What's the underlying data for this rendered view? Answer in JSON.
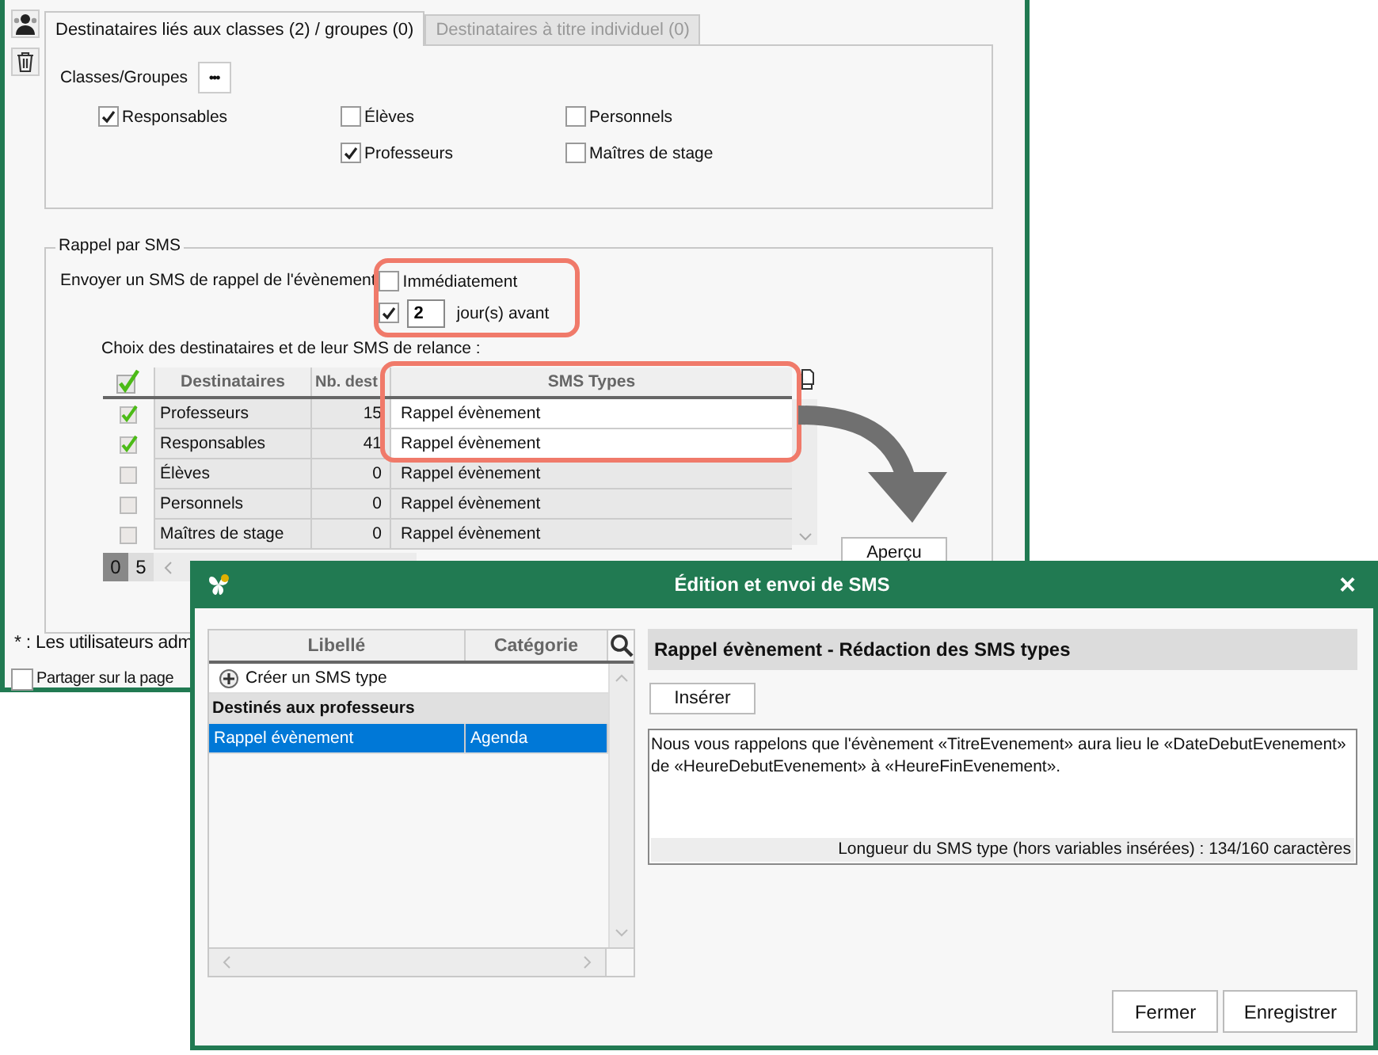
{
  "main_window": {
    "tabs": [
      {
        "label": "Destinataires liés aux classes (2) / groupes (0)",
        "selected": true
      },
      {
        "label": "Destinataires à titre individuel (0)",
        "selected": false
      }
    ],
    "classes_groups": {
      "label": "Classes/Groupes",
      "button": "•••"
    },
    "recipient_columns": [
      [
        {
          "label": "Responsables",
          "checked": true
        }
      ],
      [
        {
          "label": "Élèves",
          "checked": false
        },
        {
          "label": "Professeurs",
          "checked": true
        }
      ],
      [
        {
          "label": "Personnels",
          "checked": false
        },
        {
          "label": "Maîtres de stage",
          "checked": false
        }
      ]
    ],
    "sms_reminder": {
      "legend": "Rappel par SMS",
      "label": "Envoyer un SMS de rappel de l'évènement",
      "options": [
        {
          "kind": "checkbox",
          "label": "Immédiatement",
          "checked": false
        },
        {
          "kind": "days",
          "checked": true,
          "value": "2",
          "label": "jour(s) avant"
        }
      ],
      "table_caption": "Choix des destinataires et de leur SMS de relance :",
      "table": {
        "header_checked": true,
        "columns": [
          "Destinataires",
          "Nb. dest",
          "SMS Types"
        ],
        "rows": [
          {
            "checked": true,
            "recipients": "Professeurs",
            "count": "15",
            "sms_type": "Rappel évènement"
          },
          {
            "checked": true,
            "recipients": "Responsables",
            "count": "41",
            "sms_type": "Rappel évènement"
          },
          {
            "checked": false,
            "recipients": "Élèves",
            "count": "0",
            "sms_type": "Rappel évènement"
          },
          {
            "checked": false,
            "recipients": "Personnels",
            "count": "0",
            "sms_type": "Rappel évènement"
          },
          {
            "checked": false,
            "recipients": "Maîtres de stage",
            "count": "0",
            "sms_type": "Rappel évènement"
          }
        ]
      },
      "pager": [
        {
          "label": "0",
          "selected": true
        },
        {
          "label": "5",
          "selected": false
        }
      ],
      "preview_button": "Aperçu"
    },
    "footnote": "* : Les utilisateurs adm",
    "share": {
      "label": "Partager sur la page",
      "checked": false
    }
  },
  "dialog": {
    "title": "Édition et envoi de SMS",
    "close": "×",
    "list": {
      "columns": [
        "Libellé",
        "Catégorie"
      ],
      "rows": [
        {
          "kind": "create",
          "label": "Créer un SMS type"
        },
        {
          "kind": "group",
          "label": "Destinés aux professeurs"
        },
        {
          "kind": "item",
          "label": "Rappel évènement",
          "category": "Agenda",
          "selected": true
        }
      ]
    },
    "editor": {
      "title": "Rappel évènement - Rédaction des SMS types",
      "insert_button": "Insérer",
      "text": "Nous vous rappelons que l'évènement «TitreEvenement» aura lieu le «DateDebutEvenement» de «HeureDebutEvenement» à «HeureFinEvenement».",
      "status": "Longueur du SMS type (hors variables insérées) : 134/160 caractères"
    },
    "buttons": [
      "Fermer",
      "Enregistrer"
    ]
  }
}
